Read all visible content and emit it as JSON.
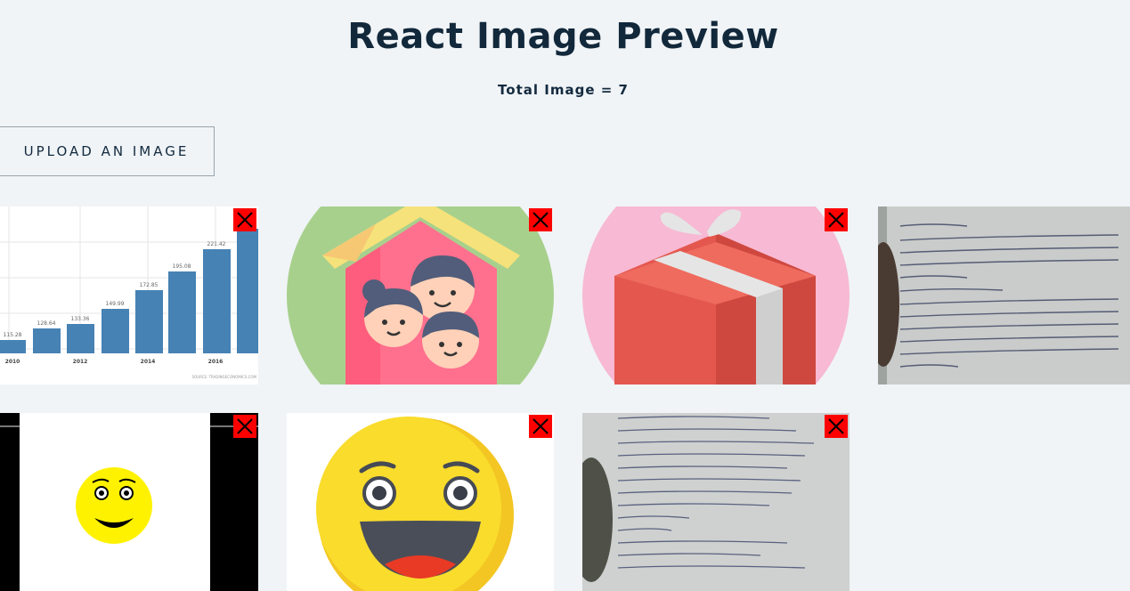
{
  "page": {
    "title": "React Image Preview",
    "total_label": "Total Image = 7"
  },
  "upload": {
    "label": "UPLOAD AN IMAGE"
  },
  "images": [
    {
      "name": "bar-chart-thumbnail",
      "bar_labels": [
        "115.28",
        "128.64",
        "133.36",
        "149.99",
        "172.85",
        "195.08",
        "221.42"
      ],
      "year_labels": [
        "2010",
        "2012",
        "2014",
        "2016"
      ],
      "source_text": "SOURCE: TRADINGECONOMICS.COM"
    },
    {
      "name": "family-house-icon-thumbnail"
    },
    {
      "name": "gift-box-icon-thumbnail"
    },
    {
      "name": "handwritten-notes-thumbnail-1"
    },
    {
      "name": "smiley-screenshot-thumbnail"
    },
    {
      "name": "laughing-emoji-thumbnail"
    },
    {
      "name": "handwritten-notes-thumbnail-2"
    }
  ],
  "icons": {
    "delete": "close-x-icon"
  },
  "colors": {
    "delete_bg": "#ff0000",
    "background": "#f0f4f7",
    "title": "#12283b"
  }
}
